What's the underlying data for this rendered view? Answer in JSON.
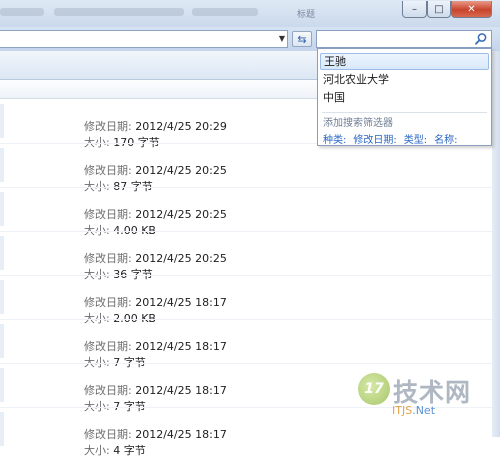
{
  "window": {
    "title": "标题",
    "min_glyph": "–",
    "max_glyph": "□",
    "close_glyph": "✕"
  },
  "toolbar": {
    "dropdown_glyph": "▼",
    "refresh_glyph": "⇆"
  },
  "search": {
    "value": "",
    "suggestions": [
      "王驰",
      "河北农业大学",
      "中国"
    ],
    "add_filter_label": "添加搜索筛选器",
    "filters": [
      "种类:",
      "修改日期:",
      "类型:",
      "名称:"
    ]
  },
  "files": {
    "modified_label": "修改日期:",
    "size_label": "大小:",
    "items": [
      {
        "modified": "2012/4/25 20:29",
        "size": "170 字节"
      },
      {
        "modified": "2012/4/25 20:25",
        "size": "87 字节"
      },
      {
        "modified": "2012/4/25 20:25",
        "size": "4.00 KB"
      },
      {
        "modified": "2012/4/25 20:25",
        "size": "36 字节"
      },
      {
        "modified": "2012/4/25 18:17",
        "size": "2.00 KB"
      },
      {
        "modified": "2012/4/25 18:17",
        "size": "7 字节"
      },
      {
        "modified": "2012/4/25 18:17",
        "size": "7 字节"
      },
      {
        "modified": "2012/4/25 18:17",
        "size": "4 字节"
      }
    ]
  },
  "watermark": {
    "logo_glyph": "17",
    "text": "技术网",
    "url_part1": "ITJS",
    "url_part2": ".Net",
    "url_part1_color": "#e0922a",
    "url_part2_color": "#3c7fd0"
  }
}
